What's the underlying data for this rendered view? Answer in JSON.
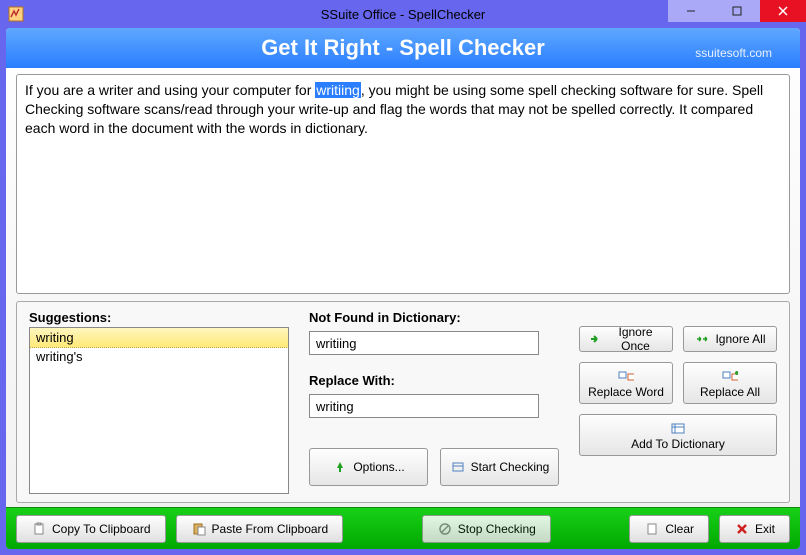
{
  "window": {
    "title": "SSuite Office - SpellChecker"
  },
  "banner": {
    "title": "Get It Right - Spell Checker",
    "subtitle": "ssuitesoft.com"
  },
  "document": {
    "text_before": "If you are a writer and using your computer for ",
    "highlighted_word": "writiing",
    "text_after": ", you might be using some spell checking software for sure. Spell Checking software scans/read through your write-up and flag the words that may not be spelled correctly. It compared each word in the document with the words in dictionary."
  },
  "suggestions": {
    "label": "Suggestions:",
    "items": [
      "writing",
      "writing's"
    ],
    "selected_index": 0
  },
  "fields": {
    "not_found_label": "Not Found in Dictionary:",
    "not_found_value": "writiing",
    "replace_with_label": "Replace With:",
    "replace_with_value": "writing"
  },
  "buttons": {
    "ignore_once": "Ignore Once",
    "ignore_all": "Ignore All",
    "replace_word": "Replace Word",
    "replace_all": "Replace All",
    "add_to_dictionary": "Add To Dictionary",
    "options": "Options...",
    "start_checking": "Start Checking",
    "copy_clipboard": "Copy To Clipboard",
    "paste_clipboard": "Paste From Clipboard",
    "stop_checking": "Stop Checking",
    "clear": "Clear",
    "exit": "Exit"
  }
}
